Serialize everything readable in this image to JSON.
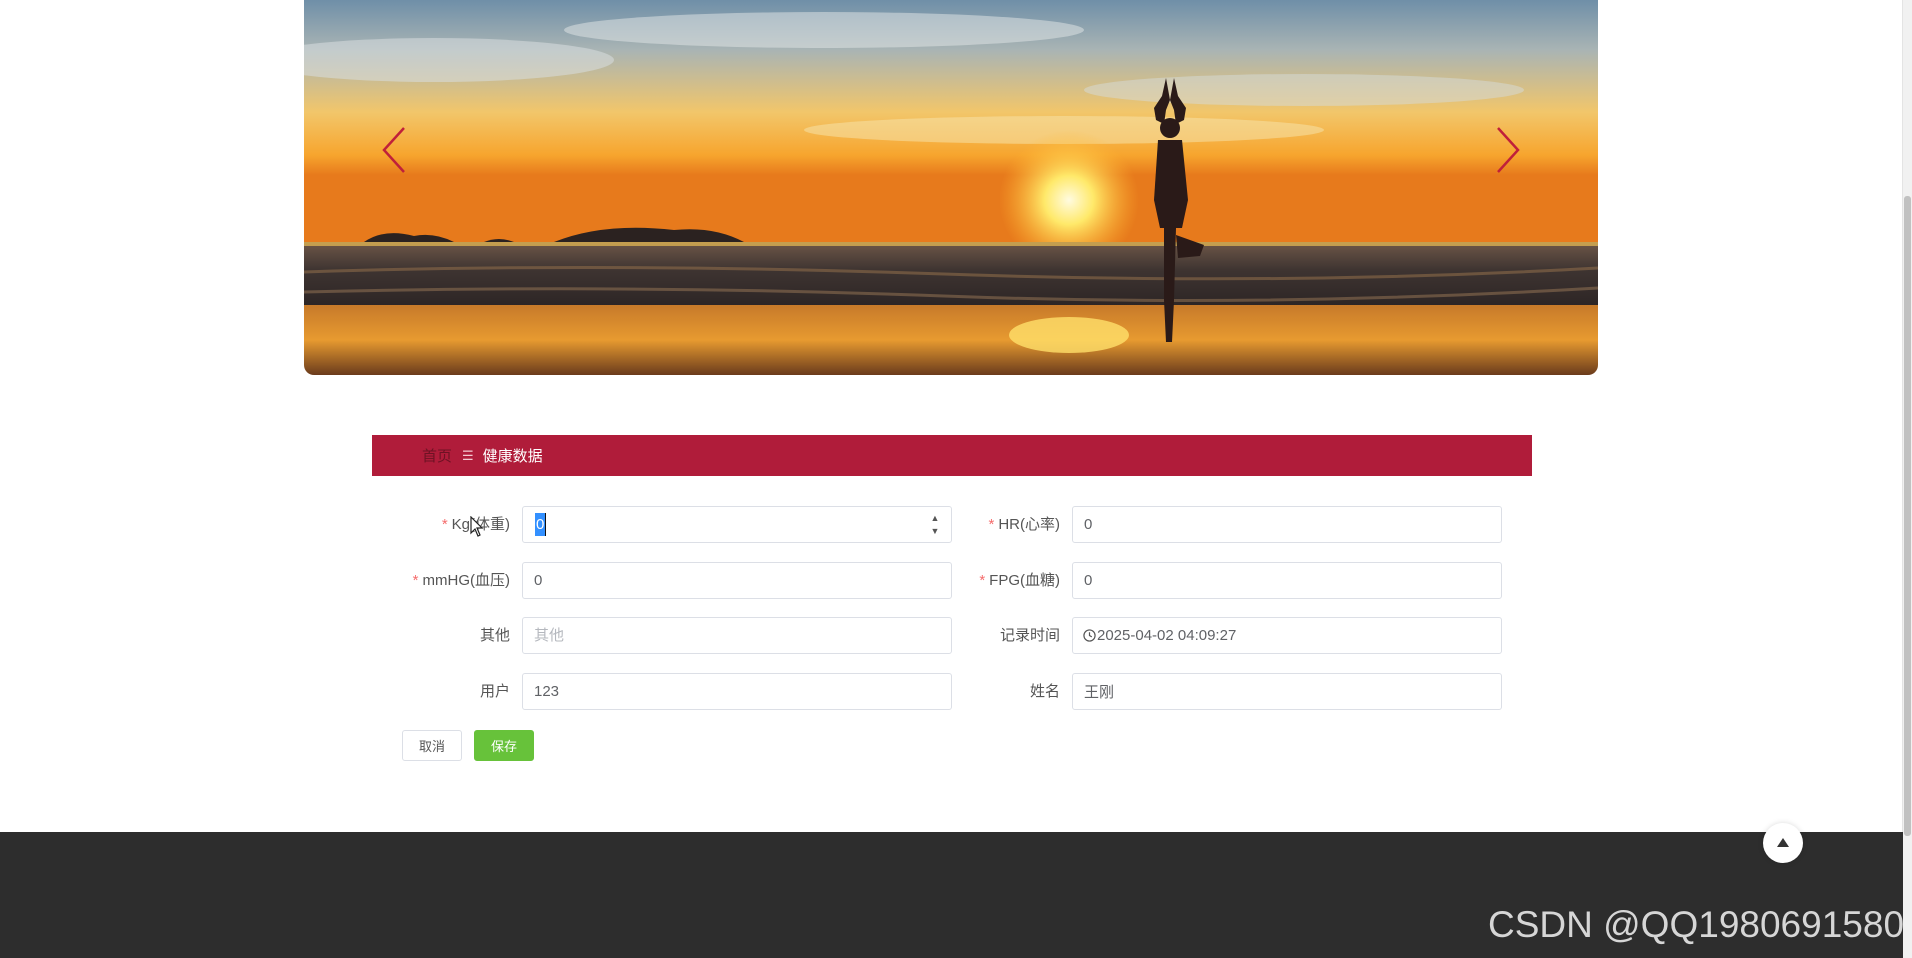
{
  "breadcrumb": {
    "home": "首页",
    "separator": "☰",
    "current": "健康数据"
  },
  "form": {
    "weight": {
      "label": "Kg(体重)",
      "required": true,
      "value": "0"
    },
    "heart_rate": {
      "label": "HR(心率)",
      "required": true,
      "value": "0"
    },
    "blood_pressure": {
      "label": "mmHG(血压)",
      "required": true,
      "value": "0"
    },
    "blood_sugar": {
      "label": "FPG(血糖)",
      "required": true,
      "value": "0"
    },
    "other": {
      "label": "其他",
      "value": "",
      "placeholder": "其他"
    },
    "record_time": {
      "label": "记录时间",
      "value": "2025-04-02 04:09:27"
    },
    "user": {
      "label": "用户",
      "value": "123"
    },
    "name": {
      "label": "姓名",
      "value": "王刚"
    }
  },
  "buttons": {
    "cancel": "取消",
    "save": "保存"
  },
  "watermark": "CSDN @QQ1980691580",
  "colors": {
    "accent": "#b01c3a",
    "save": "#67c23a",
    "footer": "#2d2d2d",
    "required": "#f56c6c"
  },
  "icons": [
    "chevron-left-icon",
    "chevron-right-icon",
    "clock-icon",
    "caret-up-icon",
    "mouse-cursor-icon"
  ]
}
